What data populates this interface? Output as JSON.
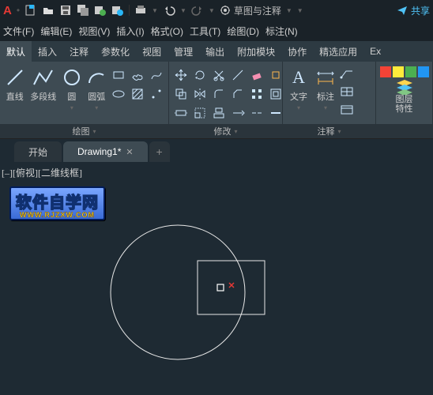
{
  "titlebar": {
    "workspace_label": "草图与注释",
    "share_label": "共享"
  },
  "menu": {
    "file": "文件(F)",
    "edit": "编辑(E)",
    "view": "视图(V)",
    "insert": "插入(I)",
    "format": "格式(O)",
    "tools": "工具(T)",
    "draw": "绘图(D)",
    "dimension": "标注(N)"
  },
  "ribbon_tabs": {
    "default": "默认",
    "insert": "插入",
    "annotate": "注释",
    "parametric": "参数化",
    "view": "视图",
    "manage": "管理",
    "output": "输出",
    "addins": "附加模块",
    "collab": "协作",
    "express": "精选应用",
    "ex": "Ex"
  },
  "ribbon": {
    "draw": {
      "line": "直线",
      "polyline": "多段线",
      "circle": "圆",
      "arc": "圆弧",
      "panel": "绘图"
    },
    "modify": {
      "panel": "修改"
    },
    "annotate": {
      "text": "文字",
      "dim": "标注",
      "panel": "注释"
    },
    "layers": {
      "panel_l1": "图层",
      "panel_l2": "特性"
    }
  },
  "doc_tabs": {
    "start": "开始",
    "drawing": "Drawing1*"
  },
  "canvas": {
    "view_state": "[–][俯视][二维线框]",
    "watermark_main": "软件自学网",
    "watermark_sub": "WWW.RJZXW.COM"
  }
}
